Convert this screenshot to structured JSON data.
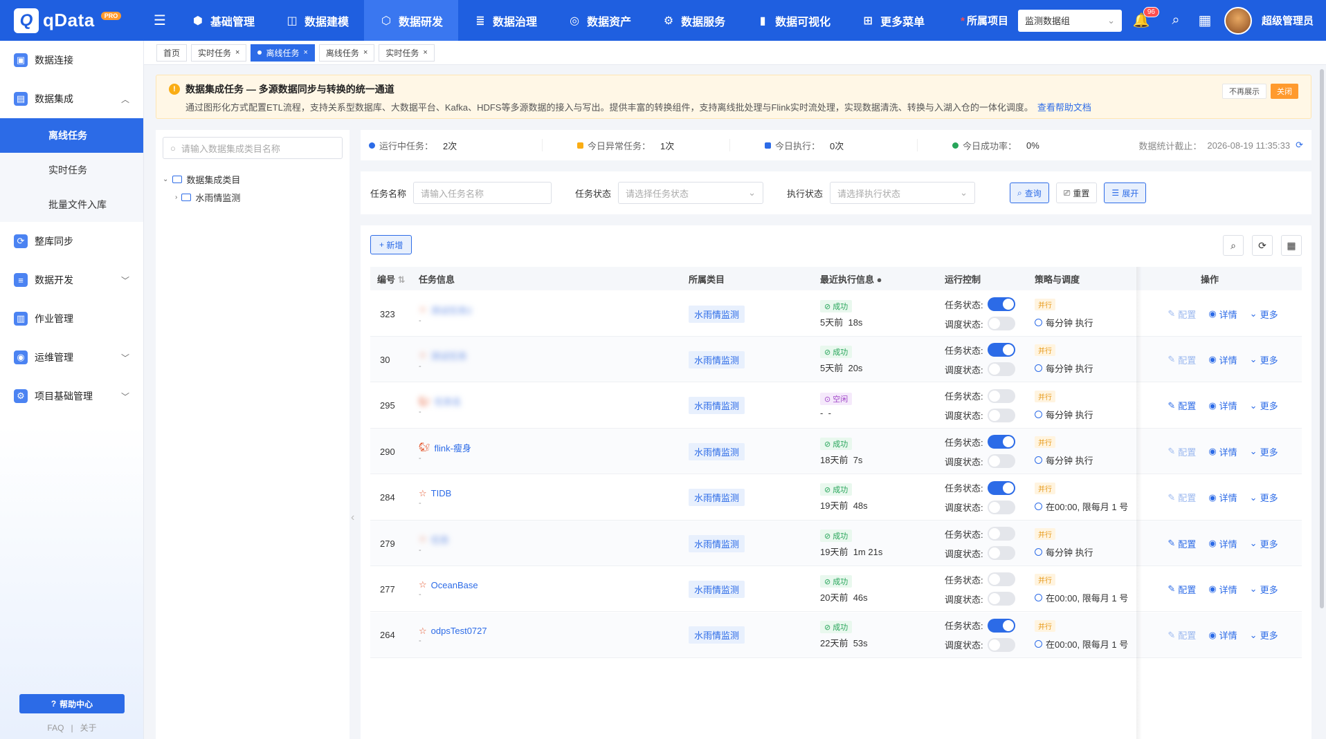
{
  "brand": {
    "name": "qData",
    "badge": "PRO"
  },
  "nav": [
    {
      "label": "基础管理",
      "icon": "cube-icon"
    },
    {
      "label": "数据建模",
      "icon": "model-icon"
    },
    {
      "label": "数据研发",
      "icon": "dev-icon",
      "active": true
    },
    {
      "label": "数据治理",
      "icon": "database-icon"
    },
    {
      "label": "数据资产",
      "icon": "asset-icon"
    },
    {
      "label": "数据服务",
      "icon": "service-icon"
    },
    {
      "label": "数据可视化",
      "icon": "chart-icon"
    },
    {
      "label": "更多菜单",
      "icon": "more-icon"
    }
  ],
  "header": {
    "project_label": "所属项目",
    "project_value": "监测数据组",
    "notifications": "96",
    "user": "超级管理员"
  },
  "sidebar": {
    "items": [
      {
        "label": "数据连接"
      },
      {
        "label": "数据集成"
      },
      {
        "label": "整库同步"
      },
      {
        "label": "数据开发"
      },
      {
        "label": "作业管理"
      },
      {
        "label": "运维管理"
      },
      {
        "label": "项目基础管理"
      }
    ],
    "subitems": [
      {
        "label": "离线任务",
        "active": true
      },
      {
        "label": "实时任务"
      },
      {
        "label": "批量文件入库"
      }
    ],
    "help": "帮助中心",
    "faq": "FAQ",
    "about": "关于",
    "sep": "|"
  },
  "tabs": [
    {
      "label": "首页"
    },
    {
      "label": "实时任务"
    },
    {
      "label": "离线任务",
      "active": true
    },
    {
      "label": "离线任务"
    },
    {
      "label": "实时任务"
    }
  ],
  "notice": {
    "title": "数据集成任务 — 多源数据同步与转换的统一通道",
    "desc": "通过图形化方式配置ETL流程，支持关系型数据库、大数据平台、Kafka、HDFS等多源数据的接入与写出。提供丰富的转换组件，支持离线批处理与Flink实时流处理，实现数据清洗、转换与入湖入仓的一体化调度。",
    "link": "查看帮助文档",
    "dismiss": "不再展示",
    "close": "关闭"
  },
  "tree": {
    "placeholder": "请输入数据集成类目名称",
    "root": "数据集成类目",
    "child": "水雨情监测"
  },
  "stats": {
    "running_label": "运行中任务：",
    "running": "2次",
    "abnormal_label": "今日异常任务：",
    "abnormal": "1次",
    "executed_label": "今日执行：",
    "executed": "0次",
    "success_label": "今日成功率：",
    "success": "0%",
    "stamp_label": "数据统计截止：",
    "stamp": "2026-08-19 11:35:33",
    "colors": {
      "running": "#2c6be7",
      "abnormal": "#faad14",
      "executed": "#2c6be7",
      "success": "#27a55a"
    }
  },
  "filters": {
    "name_label": "任务名称",
    "name_placeholder": "请输入任务名称",
    "status_label": "任务状态",
    "status_placeholder": "请选择任务状态",
    "exec_label": "执行状态",
    "exec_placeholder": "请选择执行状态",
    "query": "查询",
    "reset": "重置",
    "expand": "展开"
  },
  "table": {
    "add": "新增",
    "headers": [
      "编号",
      "任务信息",
      "所属类目",
      "最近执行信息",
      "运行控制",
      "策略与调度",
      "操作"
    ],
    "task_state_label": "任务状态:",
    "schedule_state_label": "调度状态:",
    "parallel": "并行",
    "op_config": "配置",
    "op_detail": "详情",
    "op_more": "更多",
    "rows": [
      {
        "id": "323",
        "name": "测试任务2",
        "blur": true,
        "icon": "star-icon",
        "category": "水雨情监测",
        "status": "成功",
        "ago": "5天前",
        "duration": "18s",
        "task_on": true,
        "sched_on": false,
        "schedule": "每分钟 执行",
        "config_enabled": false
      },
      {
        "id": "30",
        "name": "测试任务",
        "blur": true,
        "icon": "star-icon",
        "category": "水雨情监测",
        "status": "成功",
        "ago": "5天前",
        "duration": "20s",
        "task_on": true,
        "sched_on": false,
        "schedule": "每分钟 执行",
        "config_enabled": false
      },
      {
        "id": "295",
        "name": "任务名",
        "blur": true,
        "icon": "flink-icon",
        "category": "水雨情监测",
        "status": "空闲",
        "ago": "-",
        "duration": "-",
        "task_on": false,
        "sched_on": false,
        "schedule": "每分钟 执行",
        "config_enabled": true
      },
      {
        "id": "290",
        "name": "flink-瘦身",
        "blur": false,
        "icon": "flink-icon",
        "category": "水雨情监测",
        "status": "成功",
        "ago": "18天前",
        "duration": "7s",
        "task_on": true,
        "sched_on": false,
        "schedule": "每分钟 执行",
        "config_enabled": false
      },
      {
        "id": "284",
        "name": "TIDB",
        "blur": false,
        "icon": "star-icon",
        "category": "水雨情监测",
        "status": "成功",
        "ago": "19天前",
        "duration": "48s",
        "task_on": true,
        "sched_on": false,
        "schedule": "在00:00, 限每月 1 号",
        "config_enabled": false
      },
      {
        "id": "279",
        "name": "任务",
        "blur": true,
        "icon": "star-icon",
        "category": "水雨情监测",
        "status": "成功",
        "ago": "19天前",
        "duration": "1m 21s",
        "task_on": false,
        "sched_on": false,
        "schedule": "每分钟 执行",
        "config_enabled": true
      },
      {
        "id": "277",
        "name": "OceanBase",
        "blur": false,
        "icon": "star-icon",
        "category": "水雨情监测",
        "status": "成功",
        "ago": "20天前",
        "duration": "46s",
        "task_on": false,
        "sched_on": false,
        "schedule": "在00:00, 限每月 1 号",
        "config_enabled": true
      },
      {
        "id": "264",
        "name": "odpsTest0727",
        "blur": false,
        "icon": "star-icon",
        "category": "水雨情监测",
        "status": "成功",
        "ago": "22天前",
        "duration": "53s",
        "task_on": true,
        "sched_on": false,
        "schedule": "在00:00, 限每月 1 号",
        "config_enabled": false
      }
    ]
  }
}
